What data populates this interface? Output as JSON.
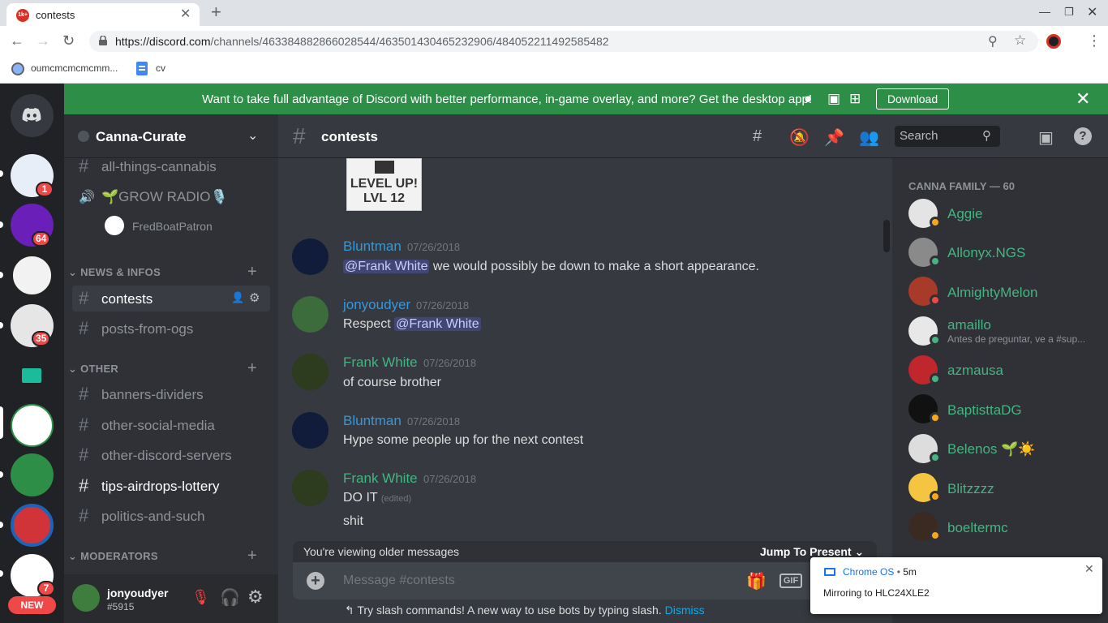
{
  "browser": {
    "tab_title": "contests",
    "tab_favicon_text": "1k+",
    "url_host": "https://discord.com",
    "url_path": "/channels/463384882866028544/463501430465232906/484052211492585482",
    "bookmarks": [
      {
        "label": "oumcmcmcmcmm..."
      },
      {
        "label": "cv"
      }
    ]
  },
  "banner": {
    "text": "Want to take full advantage of Discord with better performance, in-game overlay, and more? Get the desktop app!",
    "download_label": "Download"
  },
  "guilds": {
    "badges": [
      "1",
      "64",
      "35",
      "7"
    ],
    "new_label": "NEW"
  },
  "sidebar": {
    "server_name": "Canna-Curate",
    "channels_top": [
      {
        "name": "all-things-cannabis"
      }
    ],
    "voice_channel": "🌱GROW RADIO🎙️",
    "voice_user": "FredBoatPatron",
    "cat_news": "NEWS & INFOS",
    "news_channels": [
      {
        "name": "contests"
      },
      {
        "name": "posts-from-ogs"
      }
    ],
    "cat_other": "OTHER",
    "other_channels": [
      {
        "name": "banners-dividers"
      },
      {
        "name": "other-social-media"
      },
      {
        "name": "other-discord-servers"
      },
      {
        "name": "tips-airdrops-lottery"
      },
      {
        "name": "politics-and-such"
      }
    ],
    "cat_mods": "MODERATORS",
    "user_name": "jonyoudyer",
    "user_tag": "#5915"
  },
  "chat": {
    "channel_name": "contests",
    "search_placeholder": "Search",
    "level_line1": "LEVEL UP!",
    "level_line2": "LVL 12",
    "messages": [
      {
        "author": "Bluntman",
        "date": "07/26/2018",
        "mention": "@Frank White",
        "text": " we would possibly be down to make a short appearance.",
        "color": "#3498db"
      },
      {
        "author": "jonyoudyer",
        "date": "07/26/2018",
        "text": "Respect ",
        "mention": "@Frank White",
        "color": "#3498db"
      },
      {
        "author": "Frank White",
        "date": "07/26/2018",
        "text": "of course brother",
        "color": "#43b581"
      },
      {
        "author": "Bluntman",
        "date": "07/26/2018",
        "text": "Hype some people up for the next contest",
        "color": "#3498db"
      },
      {
        "author": "Frank White",
        "date": "07/26/2018",
        "text": "DO IT",
        "edited": "(edited)",
        "text2": "shit",
        "color": "#43b581"
      }
    ],
    "older_notice": "You're viewing older messages",
    "jump_label": "Jump To Present",
    "input_placeholder": "Message #contests",
    "gif_label": "GIF",
    "slash_tip": "Try slash commands! A new way to use bots by typing slash.",
    "dismiss_label": "Dismiss"
  },
  "members": {
    "header": "CANNA FAMILY — 60",
    "list": [
      {
        "name": "Aggie",
        "status": "idle"
      },
      {
        "name": "Allonyx.NGS",
        "status": "online"
      },
      {
        "name": "AlmightyMelon",
        "status": "dnd"
      },
      {
        "name": "amaillo",
        "sub": "Antes de preguntar, ve a #sup...",
        "status": "online"
      },
      {
        "name": "azmausa",
        "status": "online"
      },
      {
        "name": "BaptisttaDG",
        "status": "idle"
      },
      {
        "name": "Belenos 🌱☀️",
        "status": "online"
      },
      {
        "name": "Blitzzzz",
        "status": "idle"
      },
      {
        "name": "boeltermc",
        "status": "idle"
      }
    ]
  },
  "toast": {
    "source": "Chrome OS",
    "time": "5m",
    "message": "Mirroring to HLC24XLE2"
  },
  "colors": {
    "green": "#43b581",
    "blurple": "#7289da",
    "red": "#f04747",
    "idle": "#faa61a"
  }
}
